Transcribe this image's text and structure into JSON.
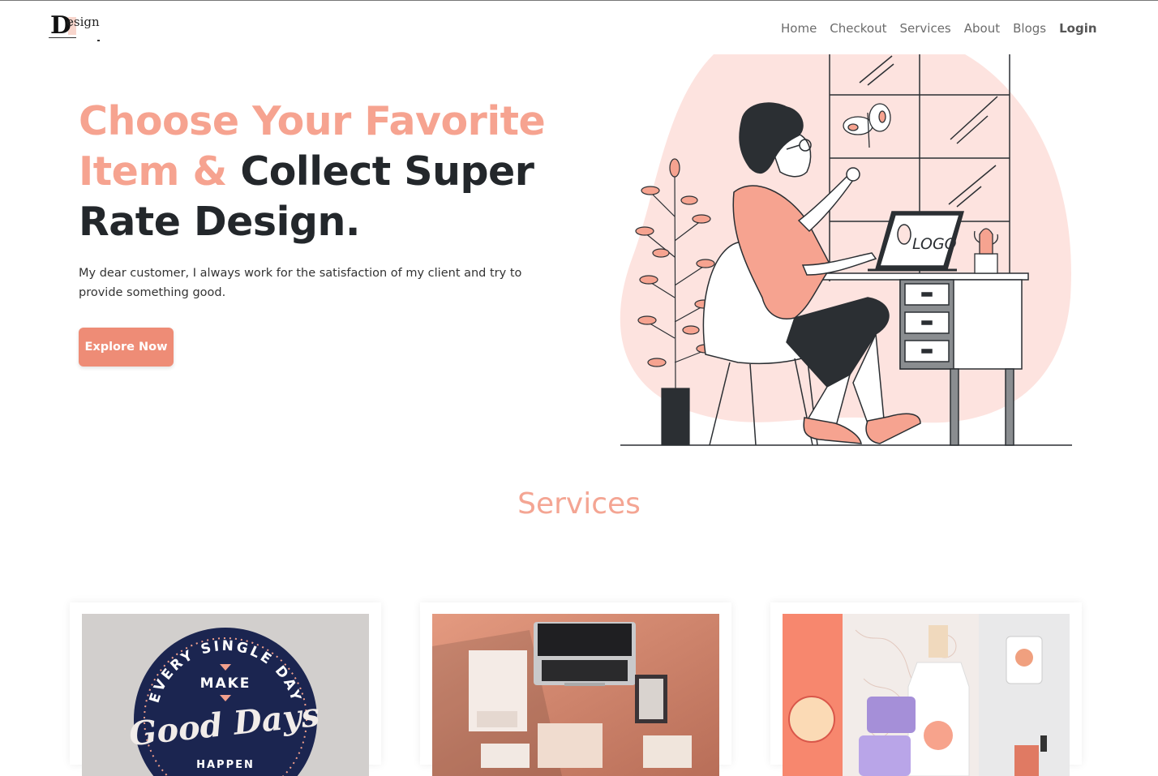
{
  "nav": {
    "logo": {
      "letter": "D",
      "text": "esign"
    },
    "links": [
      "Home",
      "Checkout",
      "Services",
      "About",
      "Blogs"
    ],
    "login": "Login"
  },
  "hero": {
    "title_accent": "Choose Your Favorite Item &",
    "title_rest": "Collect Super Rate Design.",
    "description": "My dear customer, I always work for the satisfaction of my client and try to provide something good.",
    "button": "Explore Now",
    "illustration": {
      "laptop_text": "LOGO"
    }
  },
  "services": {
    "title": "Services",
    "cards": [
      {
        "image": "good-days-badge",
        "badge_top": "EVERY SINGLE DAY",
        "badge_make": "MAKE",
        "badge_main": "Good Days",
        "badge_bottom": "HAPPEN"
      },
      {
        "image": "stationery-mockup"
      },
      {
        "image": "cosmetics-branding"
      }
    ]
  },
  "colors": {
    "accent": "#f6a390",
    "button": "#ee8c76",
    "blob": "#fde3df",
    "dark": "#23272b"
  }
}
